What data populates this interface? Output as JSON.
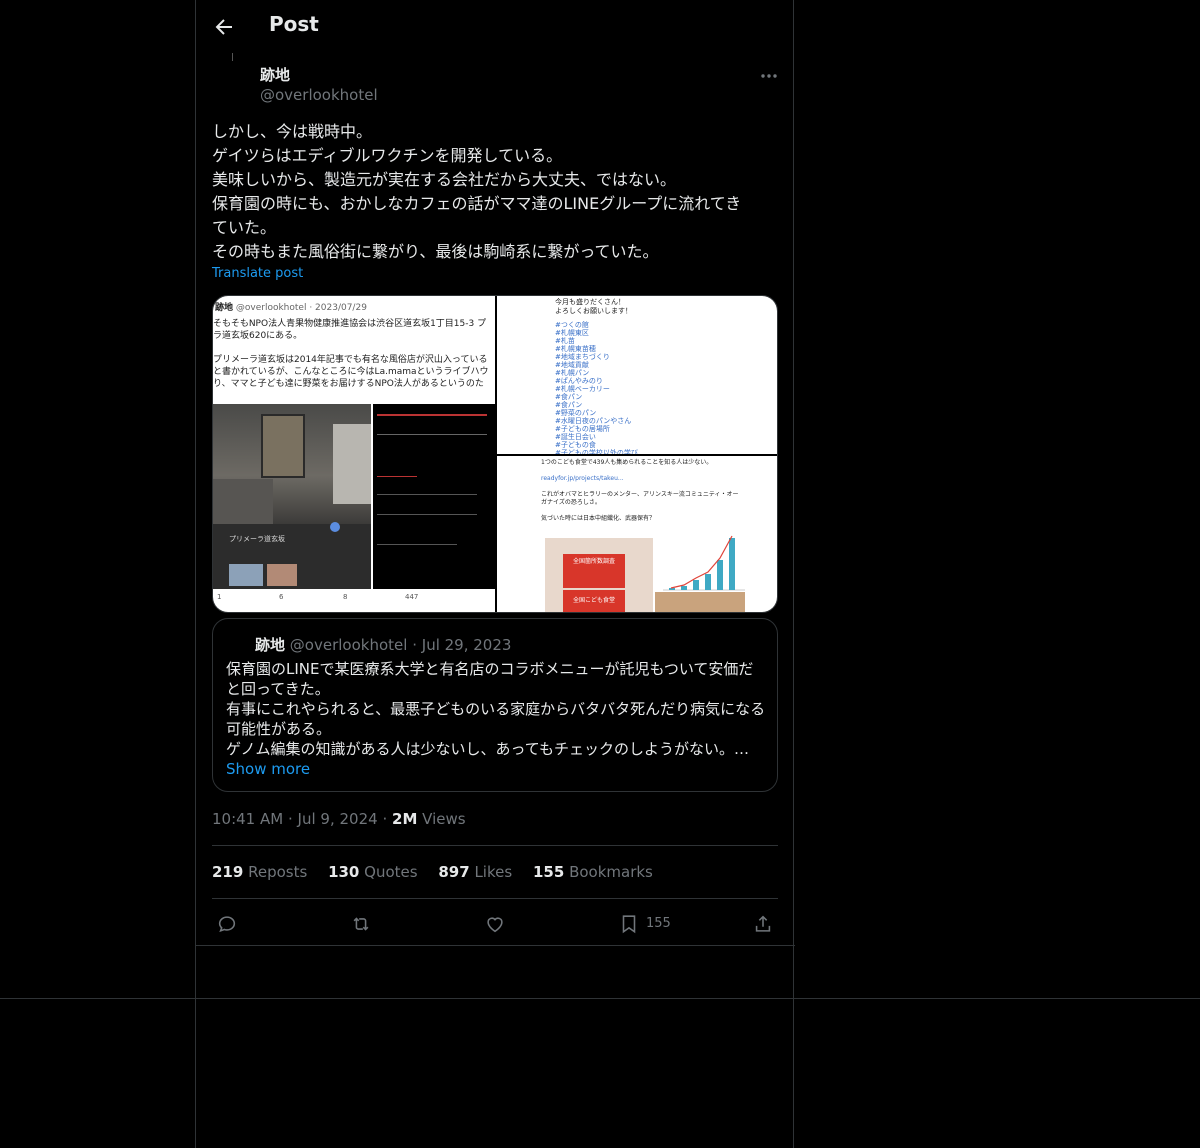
{
  "header": {
    "title": "Post"
  },
  "author": {
    "name": "跡地",
    "handle": "@overlookhotel"
  },
  "post": {
    "lines": [
      "しかし、今は戦時中。",
      "ゲイツらはエディブルワクチンを開発している。",
      "美味しいから、製造元が実在する会社だから大丈夫、ではない。",
      "保育園の時にも、おかしなカフェの話がママ達のLINEグループに流れてき",
      "ていた。",
      "その時もまた風俗街に繋がり、最後は駒崎系に繋がっていた。"
    ],
    "translate_label": "Translate post"
  },
  "media": {
    "img1": {
      "author": "跡地",
      "handle_date": "@overlookhotel · 2023/07/29",
      "lines": [
        "そもそもNPO法人青果物健康推進協会は渋谷区道玄坂1丁目15-3 プ",
        "ラ道玄坂620にある。",
        "",
        "プリメーラ道玄坂は2014年記事でも有名な風俗店が沢山入っている",
        "と書かれているが、こんなところに今はLa.mamaというライブハウ",
        "り、ママと子ども達に野菜をお届けするNPO法人があるというのた"
      ],
      "photo_caption": "プリメーラ道玄坂",
      "stats": [
        "1",
        "6",
        "8",
        "447"
      ]
    },
    "img2": {
      "lines": [
        "今月も盛りだくさん！",
        "よろしくお願いします！"
      ],
      "tags": [
        "#つくの館",
        "#札幌東区",
        "#札苗",
        "#札幌東苗穂",
        "#地域まちづくり",
        "#地域貢献",
        "#札幌パン",
        "#ぱんやみのり",
        "#札幌ベーカリー",
        "#食パン",
        "#食パン",
        "#野菜のパン",
        "#水曜日夜のパンやさん",
        "#子どもの居場所",
        "#誕生日会い",
        "#子どもの食",
        "#子どもの学校以外の学び"
      ]
    },
    "img3": {
      "lines": [
        "1つのこども食堂で439人も集められることを知る人は少ない。",
        "",
        "readyfor.jp/projects/takeu...",
        "",
        "これがオバマとヒラリーのメンター、アリンスキー流コミュニティ・オー",
        "ガナイズの恐ろしさ。",
        "",
        "気づいた時には日本中組織化、武器保有？"
      ],
      "poster_title": "全国箇所数調査",
      "poster_sub": "全国こども食堂"
    }
  },
  "quote": {
    "name": "跡地",
    "handle": "@overlookhotel",
    "separator": "·",
    "date": "Jul 29, 2023",
    "lines": [
      "保育園のLINEで某医療系大学と有名店のコラボメニューが託児もついて安価だ",
      "と回ってきた。",
      "有事にこれやられると、最悪子どものいる家庭からバタバタ死んだり病気になる",
      "可能性がある。",
      "ゲノム編集の知識がある人は少ないし、あってもチェックのしようがない。…"
    ],
    "show_more": "Show more"
  },
  "meta": {
    "time": "10:41 AM",
    "dot": "·",
    "date": "Jul 9, 2024",
    "views_count": "2M",
    "views_label": "Views"
  },
  "stats": {
    "reposts_count": "219",
    "reposts_label": "Reposts",
    "quotes_count": "130",
    "quotes_label": "Quotes",
    "likes_count": "897",
    "likes_label": "Likes",
    "bookmarks_count": "155",
    "bookmarks_label": "Bookmarks"
  },
  "actions": {
    "bookmark_count": "155"
  },
  "colors": {
    "accent": "#1d9bf0",
    "border": "#2f3336",
    "muted": "#71767b",
    "text": "#e7e9ea"
  }
}
